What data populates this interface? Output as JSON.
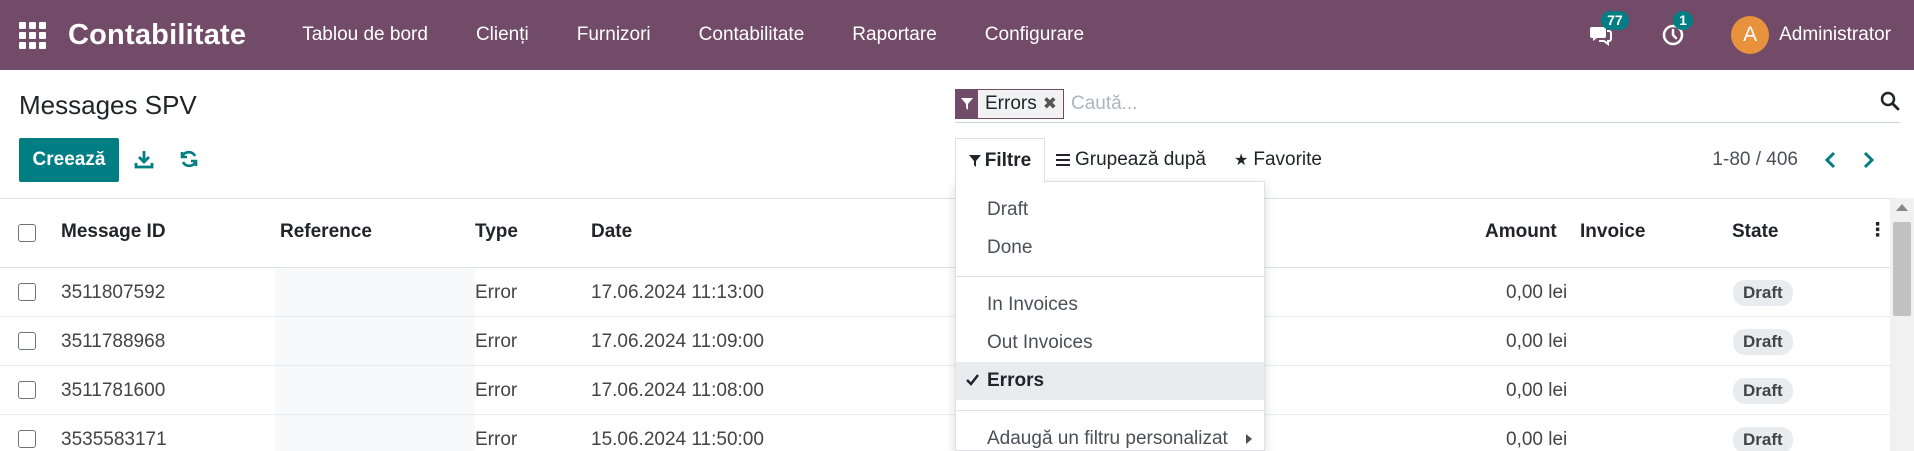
{
  "navbar": {
    "brand": "Contabilitate",
    "menu": [
      "Tablou de bord",
      "Clienți",
      "Furnizori",
      "Contabilitate",
      "Raportare",
      "Configurare"
    ],
    "messages_count": "77",
    "activities_count": "1",
    "avatar_initial": "A",
    "user_name": "Administrator",
    "bg_color": "#714B67"
  },
  "control": {
    "title": "Messages SPV",
    "create_label": "Creează",
    "search_facet": "Errors",
    "search_placeholder": "Caută...",
    "filter_label": "Filtre",
    "groupby_label": "Grupează după",
    "favorites_label": "Favorite",
    "pager": "1-80 / 406",
    "accent_color": "#017E84"
  },
  "dropdown": {
    "items": [
      "Draft",
      "Done",
      "In Invoices",
      "Out Invoices",
      "Errors"
    ],
    "active_item": "Errors",
    "custom_filter": "Adaugă un filtru personalizat"
  },
  "table": {
    "headers": {
      "message_id": "Message ID",
      "reference": "Reference",
      "type": "Type",
      "date": "Date",
      "amount": "Amount",
      "invoice": "Invoice",
      "state": "State"
    },
    "rows": [
      {
        "message_id": "3511807592",
        "reference": "",
        "type": "Error",
        "date": "17.06.2024 11:13:00",
        "amount": "0,00 lei",
        "invoice": "",
        "state": "Draft"
      },
      {
        "message_id": "3511788968",
        "reference": "",
        "type": "Error",
        "date": "17.06.2024 11:09:00",
        "amount": "0,00 lei",
        "invoice": "",
        "state": "Draft"
      },
      {
        "message_id": "3511781600",
        "reference": "",
        "type": "Error",
        "date": "17.06.2024 11:08:00",
        "amount": "0,00 lei",
        "invoice": "",
        "state": "Draft"
      },
      {
        "message_id": "3535583171",
        "reference": "",
        "type": "Error",
        "date": "15.06.2024 11:50:00",
        "amount": "0,00 lei",
        "invoice": "",
        "state": "Draft"
      }
    ]
  }
}
